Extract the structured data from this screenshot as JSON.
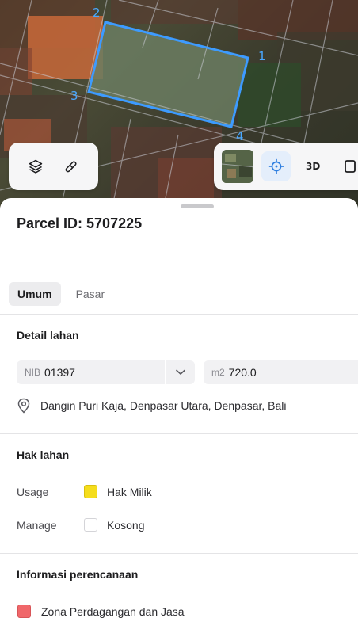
{
  "map": {
    "corners": [
      "1",
      "2",
      "3",
      "4"
    ]
  },
  "toolbar": {
    "layers_icon": "layers-icon",
    "draw_icon": "draw-icon",
    "basemap_icon": "satellite-thumbnail",
    "locate_icon": "crosshair-icon",
    "mode_3d_label": "3D"
  },
  "parcel": {
    "title": "Parcel ID: 5707225"
  },
  "tabs": [
    {
      "label": "Umum",
      "active": true
    },
    {
      "label": "Pasar",
      "active": false
    }
  ],
  "detail": {
    "heading": "Detail lahan",
    "nib_prefix": "NIB",
    "nib_value": "01397",
    "area_prefix": "m2",
    "area_value": "720.0",
    "address": "Dangin Puri Kaja, Denpasar Utara, Denpasar, Bali"
  },
  "rights": {
    "heading": "Hak lahan",
    "rows": [
      {
        "label": "Usage",
        "value": "Hak Milik",
        "color": "#f5dd1c"
      },
      {
        "label": "Manage",
        "value": "Kosong",
        "color": "#ffffff"
      }
    ]
  },
  "planning": {
    "heading": "Informasi perencanaan",
    "zone": "Zona Perdagangan dan Jasa",
    "zone_color": "#f0676a"
  },
  "colors": {
    "parcel_outline": "#3d9bff",
    "active_tab_bg": "#ececee"
  }
}
